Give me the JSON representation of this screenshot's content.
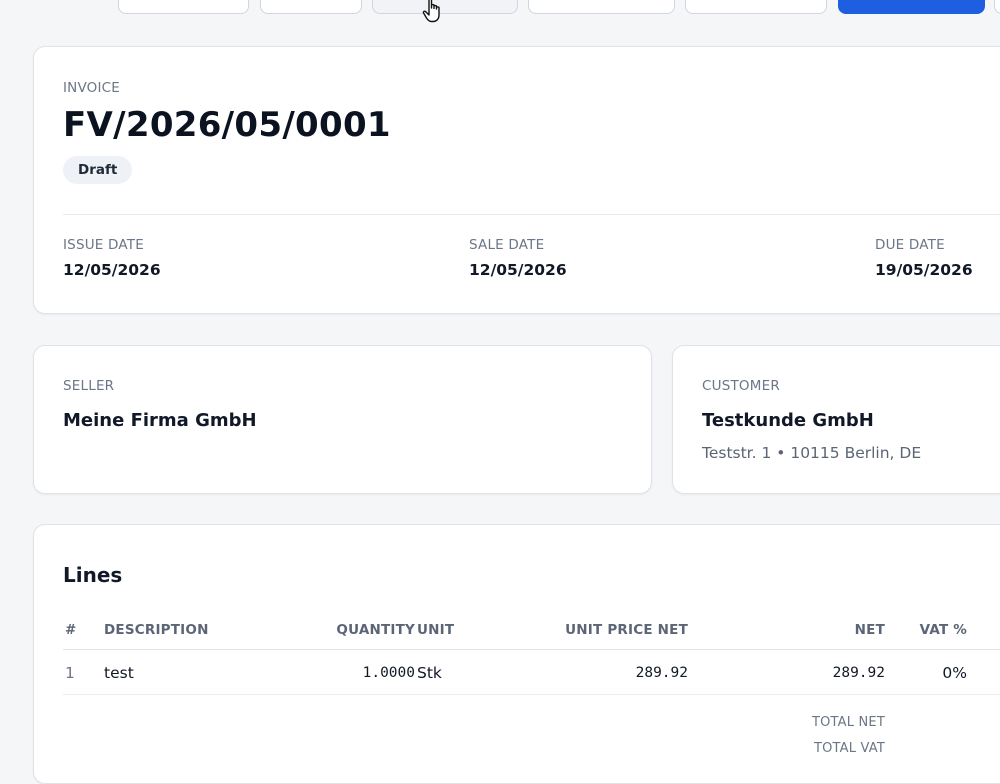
{
  "invoice": {
    "label": "INVOICE",
    "number": "FV/2026/05/0001",
    "status": "Draft",
    "dates": [
      {
        "label": "ISSUE DATE",
        "value": "12/05/2026"
      },
      {
        "label": "SALE DATE",
        "value": "12/05/2026"
      },
      {
        "label": "DUE DATE",
        "value": "19/05/2026"
      }
    ]
  },
  "seller": {
    "label": "SELLER",
    "name": "Meine Firma GmbH"
  },
  "customer": {
    "label": "CUSTOMER",
    "name": "Testkunde GmbH",
    "address": "Teststr. 1 • 10115 Berlin, DE"
  },
  "lines": {
    "title": "Lines",
    "headers": {
      "index": "#",
      "description": "DESCRIPTION",
      "quantity": "QUANTITY",
      "unit": "UNIT",
      "unit_price_net": "UNIT PRICE NET",
      "net": "NET",
      "vat": "VAT %"
    },
    "rows": [
      {
        "index": "1",
        "description": "test",
        "quantity": "1.0000",
        "unit": "Stk",
        "unit_price_net": "289.92",
        "net": "289.92",
        "vat": "0%"
      }
    ],
    "totals": {
      "total_net": "TOTAL NET",
      "total_vat": "TOTAL VAT"
    }
  },
  "colors": {
    "primary": "#1d5fe0",
    "background": "#f4f6f8"
  }
}
